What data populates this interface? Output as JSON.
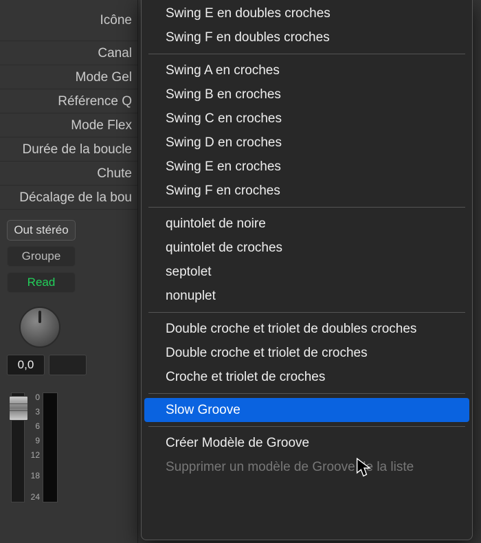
{
  "sidebar": {
    "labels": [
      "Icône",
      "Canal",
      "Mode Gel",
      "Référence Q",
      "Mode Flex",
      "Durée de la boucle",
      "Chute",
      "Décalage de la bou"
    ]
  },
  "controls": {
    "out": "Out stéréo",
    "group": "Groupe",
    "read": "Read",
    "value": "0,0"
  },
  "scale": [
    "0",
    "3",
    "6",
    "9",
    "12",
    "",
    "18",
    "",
    "24"
  ],
  "menu": {
    "g1": [
      "Swing E en doubles croches",
      "Swing F en doubles croches"
    ],
    "g2": [
      "Swing A en croches",
      "Swing B en croches",
      "Swing C en croches",
      "Swing D en croches",
      "Swing E en croches",
      "Swing F en croches"
    ],
    "g3": [
      "quintolet de noire",
      "quintolet de croches",
      "septolet",
      "nonuplet"
    ],
    "g4": [
      "Double croche et triolet de doubles croches",
      "Double croche et triolet de croches",
      "Croche et triolet de croches"
    ],
    "g5": [
      "Slow Groove"
    ],
    "g6": [
      "Créer Modèle de Groove",
      "Supprimer un modèle de Groove de la liste"
    ]
  }
}
